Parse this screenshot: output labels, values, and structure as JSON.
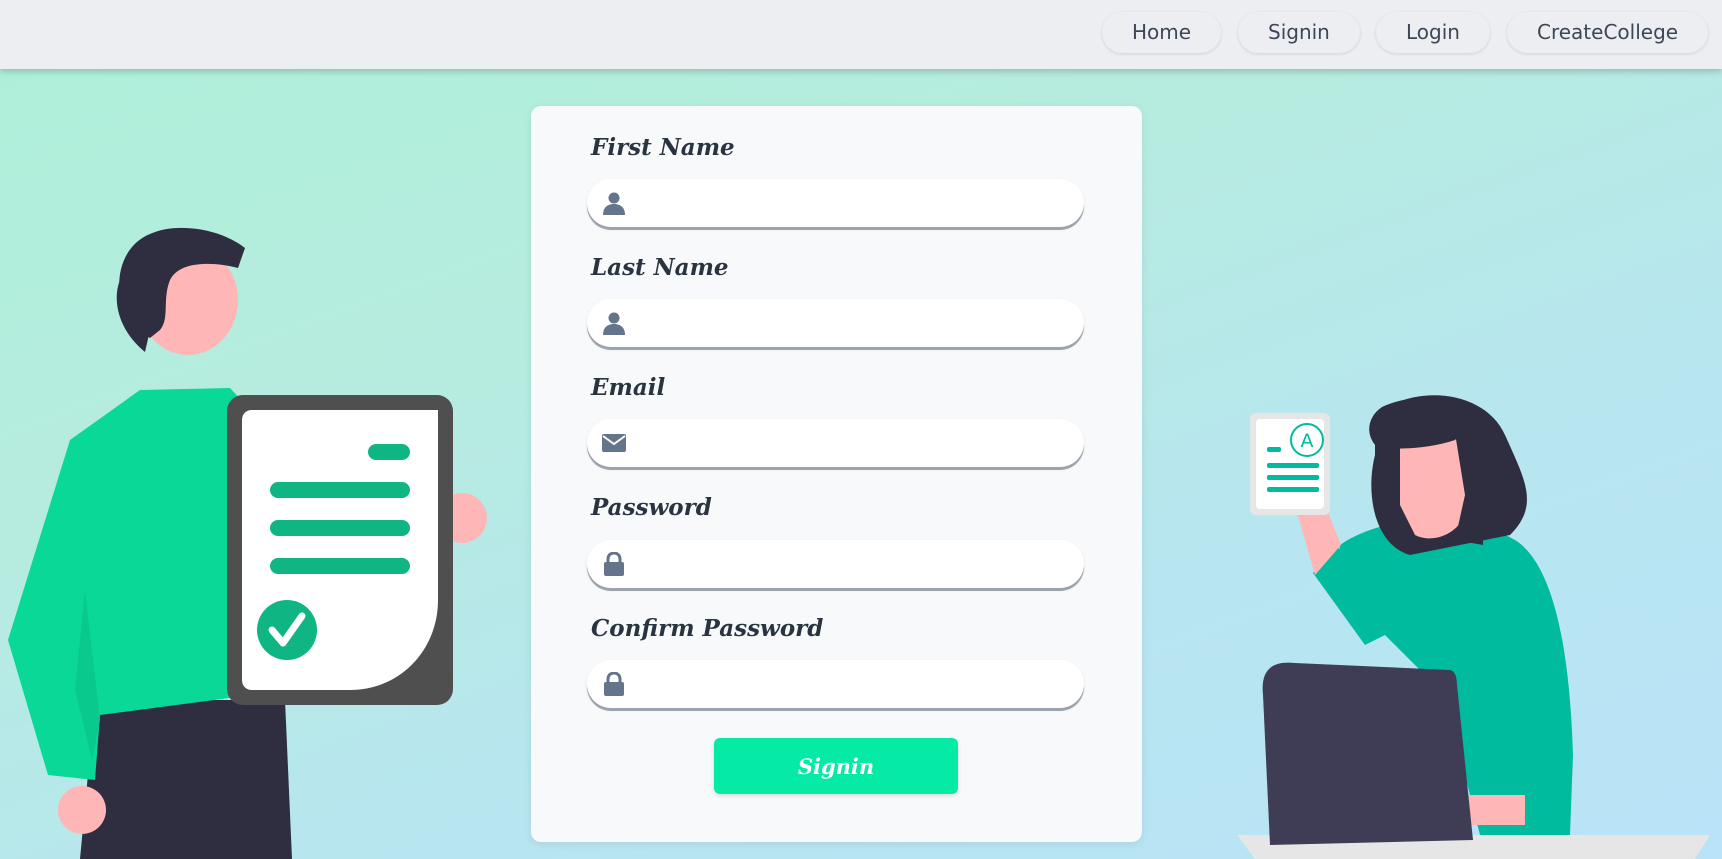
{
  "navbar": {
    "links": [
      {
        "label": "Home"
      },
      {
        "label": "Signin"
      },
      {
        "label": "Login"
      },
      {
        "label": "CreateCollege"
      }
    ]
  },
  "form": {
    "fields": [
      {
        "label": "First Name",
        "icon": "user-icon",
        "value": ""
      },
      {
        "label": "Last Name",
        "icon": "user-icon",
        "value": ""
      },
      {
        "label": "Email",
        "icon": "envelope-icon",
        "value": ""
      },
      {
        "label": "Password",
        "icon": "lock-icon",
        "value": ""
      },
      {
        "label": "Confirm Password",
        "icon": "lock-icon",
        "value": ""
      }
    ],
    "submit_label": "Signin"
  },
  "illustration": {
    "grade_letter": "A"
  },
  "colors": {
    "accent": "#05eba5",
    "shirt_left": "#0ad897",
    "shirt_right": "#00bb9e",
    "dark": "#2f2e41",
    "skin": "#ffb6b6"
  }
}
